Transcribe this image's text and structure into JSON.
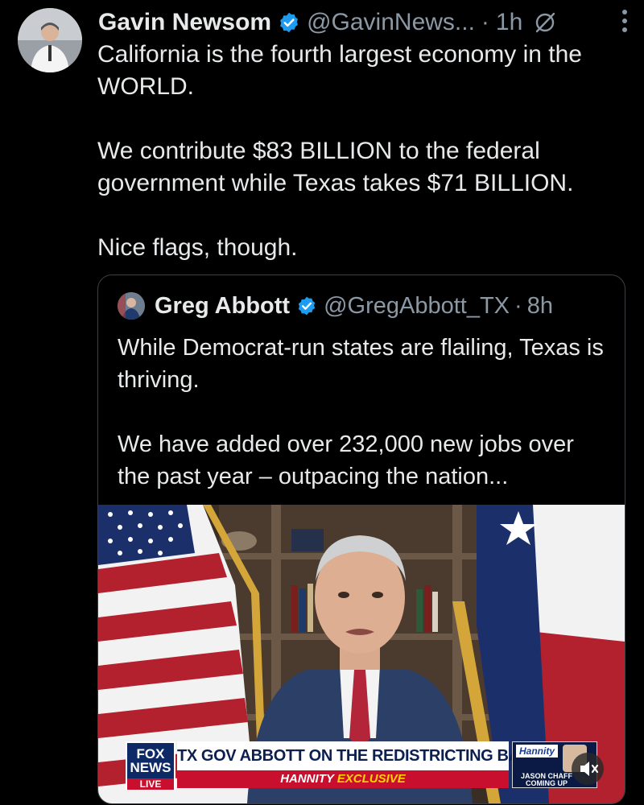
{
  "tweet": {
    "author_name": "Gavin Newsom",
    "handle": "@GavinNews...",
    "separator": "·",
    "time": "1h",
    "paragraphs": [
      "California is the fourth largest economy in the WORLD.",
      "We contribute $83 BILLION to the federal government while Texas takes $71 BILLION.",
      "Nice flags, though."
    ]
  },
  "quote": {
    "author_name": "Greg Abbott",
    "handle": "@GregAbbott_TX",
    "separator": "·",
    "time": "8h",
    "paragraphs": [
      "While Democrat-run states are flailing, Texas is thriving.",
      "We have added over 232,000 new jobs over the past year – outpacing the nation..."
    ]
  },
  "chyron": {
    "logo_line1": "FOX",
    "logo_line2": "NEWS",
    "logo_live": "LIVE",
    "headline": "TX GOV ABBOTT ON THE REDISTRICTING BATTLE",
    "sub_show": "HANNITY",
    "sub_tag": "EXCLUSIVE",
    "promo_show": "Hannity",
    "promo_guest": "JASON CHAFF",
    "promo_coming": "COMING UP"
  },
  "icons": {
    "verified": "verified-badge-icon",
    "grok": "grok-icon",
    "more": "more-options-icon",
    "mute": "muted-speaker-icon"
  },
  "colors": {
    "background": "#000000",
    "text": "#e7e9ea",
    "secondary": "#8b98a5",
    "verified": "#1d9bf0",
    "border": "#3b4044"
  }
}
